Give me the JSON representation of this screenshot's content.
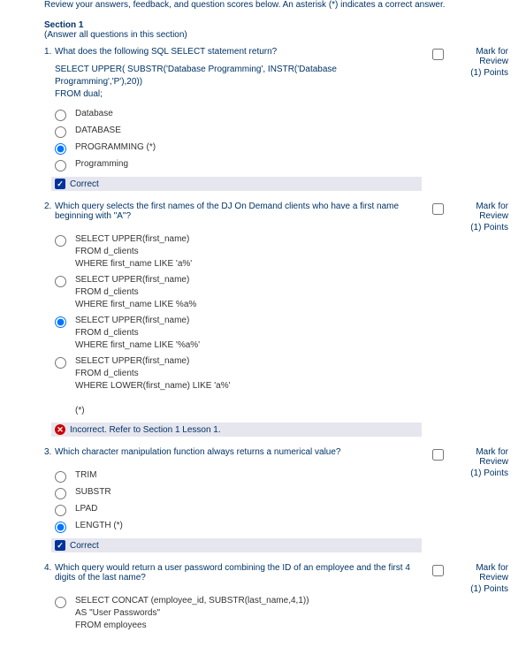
{
  "intro": "Review your answers, feedback, and question scores below. An asterisk (*) indicates a correct answer.",
  "section": {
    "title": "Section 1",
    "instruction": "(Answer all questions in this section)"
  },
  "review": {
    "label": "Mark for Review",
    "points": "(1) Points"
  },
  "feedback": {
    "correct": "Correct",
    "incorrect": "Incorrect. Refer to Section 1 Lesson 1."
  },
  "questions": [
    {
      "num": "1.",
      "text": "What does the following SQL SELECT statement return?",
      "code": [
        "SELECT UPPER( SUBSTR('Database Programming', INSTR('Database Programming','P'),20))",
        "FROM dual;"
      ],
      "options": [
        {
          "label": "Database",
          "selected": false
        },
        {
          "label": "DATABASE",
          "selected": false
        },
        {
          "label": "PROGRAMMING (*)",
          "selected": true
        },
        {
          "label": "Programming",
          "selected": false
        }
      ],
      "result": "correct"
    },
    {
      "num": "2.",
      "text": "Which query selects the first names of the DJ On Demand clients who have a first name beginning with \"A\"?",
      "options": [
        {
          "label": "SELECT UPPER(first_name)\nFROM d_clients\nWHERE first_name LIKE 'a%'",
          "selected": false
        },
        {
          "label": "SELECT UPPER(first_name)\nFROM d_clients\nWHERE first_name LIKE %a%",
          "selected": false
        },
        {
          "label": "SELECT UPPER(first_name)\nFROM d_clients\nWHERE first_name LIKE '%a%'",
          "selected": true
        },
        {
          "label": "SELECT UPPER(first_name)\nFROM d_clients\nWHERE LOWER(first_name) LIKE 'a%'\n\n(*)",
          "selected": false
        }
      ],
      "result": "incorrect"
    },
    {
      "num": "3.",
      "text": "Which character manipulation function always returns a numerical value?",
      "options": [
        {
          "label": "TRIM",
          "selected": false
        },
        {
          "label": "SUBSTR",
          "selected": false
        },
        {
          "label": "LPAD",
          "selected": false
        },
        {
          "label": "LENGTH (*)",
          "selected": true
        }
      ],
      "result": "correct"
    },
    {
      "num": "4.",
      "text": "Which query would return a user password combining the ID of an employee and the first 4 digits of the last name?",
      "options": [
        {
          "label": "SELECT CONCAT (employee_id, SUBSTR(last_name,4,1))\nAS \"User Passwords\"\nFROM employees",
          "selected": false
        }
      ]
    }
  ]
}
